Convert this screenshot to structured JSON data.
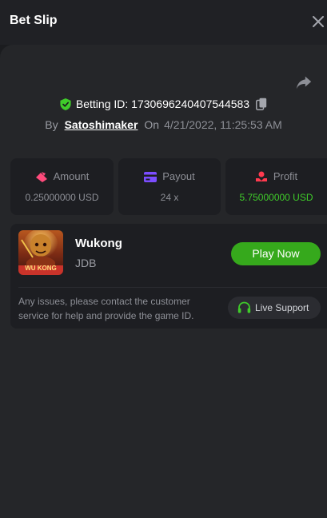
{
  "header": {
    "title": "Bet Slip",
    "close_icon": "close-icon"
  },
  "bet": {
    "betting_id_label": "Betting ID:",
    "betting_id": "1730696240407544583",
    "by_label": "By",
    "user": "Satoshimaker",
    "on_label": "On",
    "date": "4/21/2022, 11:25:53 AM"
  },
  "stats": {
    "amount": {
      "label": "Amount",
      "value": "0.25000000 USD",
      "icon": "bet-icon",
      "color": "#ff4b7c"
    },
    "payout": {
      "label": "Payout",
      "value": "24 x",
      "icon": "card-icon",
      "color": "#7c4dff"
    },
    "profit": {
      "label": "Profit",
      "value": "5.75000000 USD",
      "icon": "profit-icon",
      "color": "#ff3a4f",
      "value_color": "#3fcb2a"
    }
  },
  "game": {
    "thumb_text": "WU KONG",
    "name": "Wukong",
    "provider": "JDB",
    "play_label": "Play Now",
    "issue_text": "Any issues, please contact the customer service for help and provide the game ID.",
    "support_label": "Live Support"
  },
  "colors": {
    "accent_green": "#36a91c",
    "shield_green": "#3fcb2a",
    "background": "#1b1c1f",
    "panel": "#252629"
  }
}
